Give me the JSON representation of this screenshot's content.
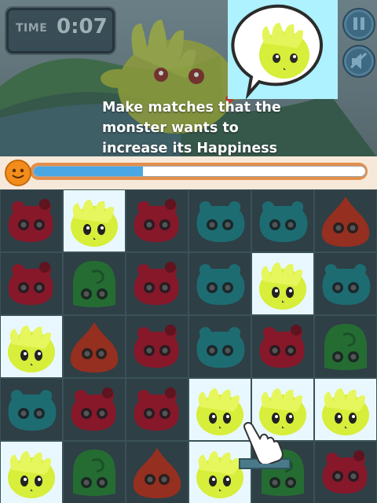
{
  "header": {
    "time_label": "TIME",
    "time_value": "0:07"
  },
  "instruction": "Make matches that the\nmonster wants to\nincrease its Happiness",
  "buttons": {
    "pause_icon": "pause-icon",
    "mute_icon": "mute-icon"
  },
  "happiness": {
    "fill_fraction": 0.33,
    "face_icon": "happy-face-icon"
  },
  "colors": {
    "yellow": "#d7ee3a",
    "red": "#c8122c",
    "teal": "#1f9aa0",
    "green": "#2c9a3a",
    "orange_red": "#e0381a",
    "highlight": "#e9f8ff"
  },
  "board": {
    "rows": [
      [
        "red-bear",
        "yellow-blob",
        "red-bear",
        "teal-bear",
        "teal-bear",
        "orange-drop"
      ],
      [
        "red-bear",
        "green-swirl",
        "red-bear",
        "teal-bear",
        "yellow-blob",
        "teal-bear"
      ],
      [
        "yellow-blob",
        "orange-drop",
        "red-bear",
        "teal-bear",
        "red-bear",
        "green-swirl"
      ],
      [
        "teal-bear",
        "red-bear",
        "red-bear",
        "yellow-blob",
        "yellow-blob",
        "yellow-blob"
      ],
      [
        "yellow-blob",
        "green-swirl",
        "orange-drop",
        "yellow-blob",
        "green-swirl",
        "red-bear"
      ]
    ],
    "highlighted": [
      [
        0,
        1
      ],
      [
        1,
        4
      ],
      [
        2,
        0
      ],
      [
        3,
        3
      ],
      [
        3,
        4
      ],
      [
        3,
        5
      ],
      [
        4,
        0
      ],
      [
        4,
        3
      ]
    ]
  }
}
